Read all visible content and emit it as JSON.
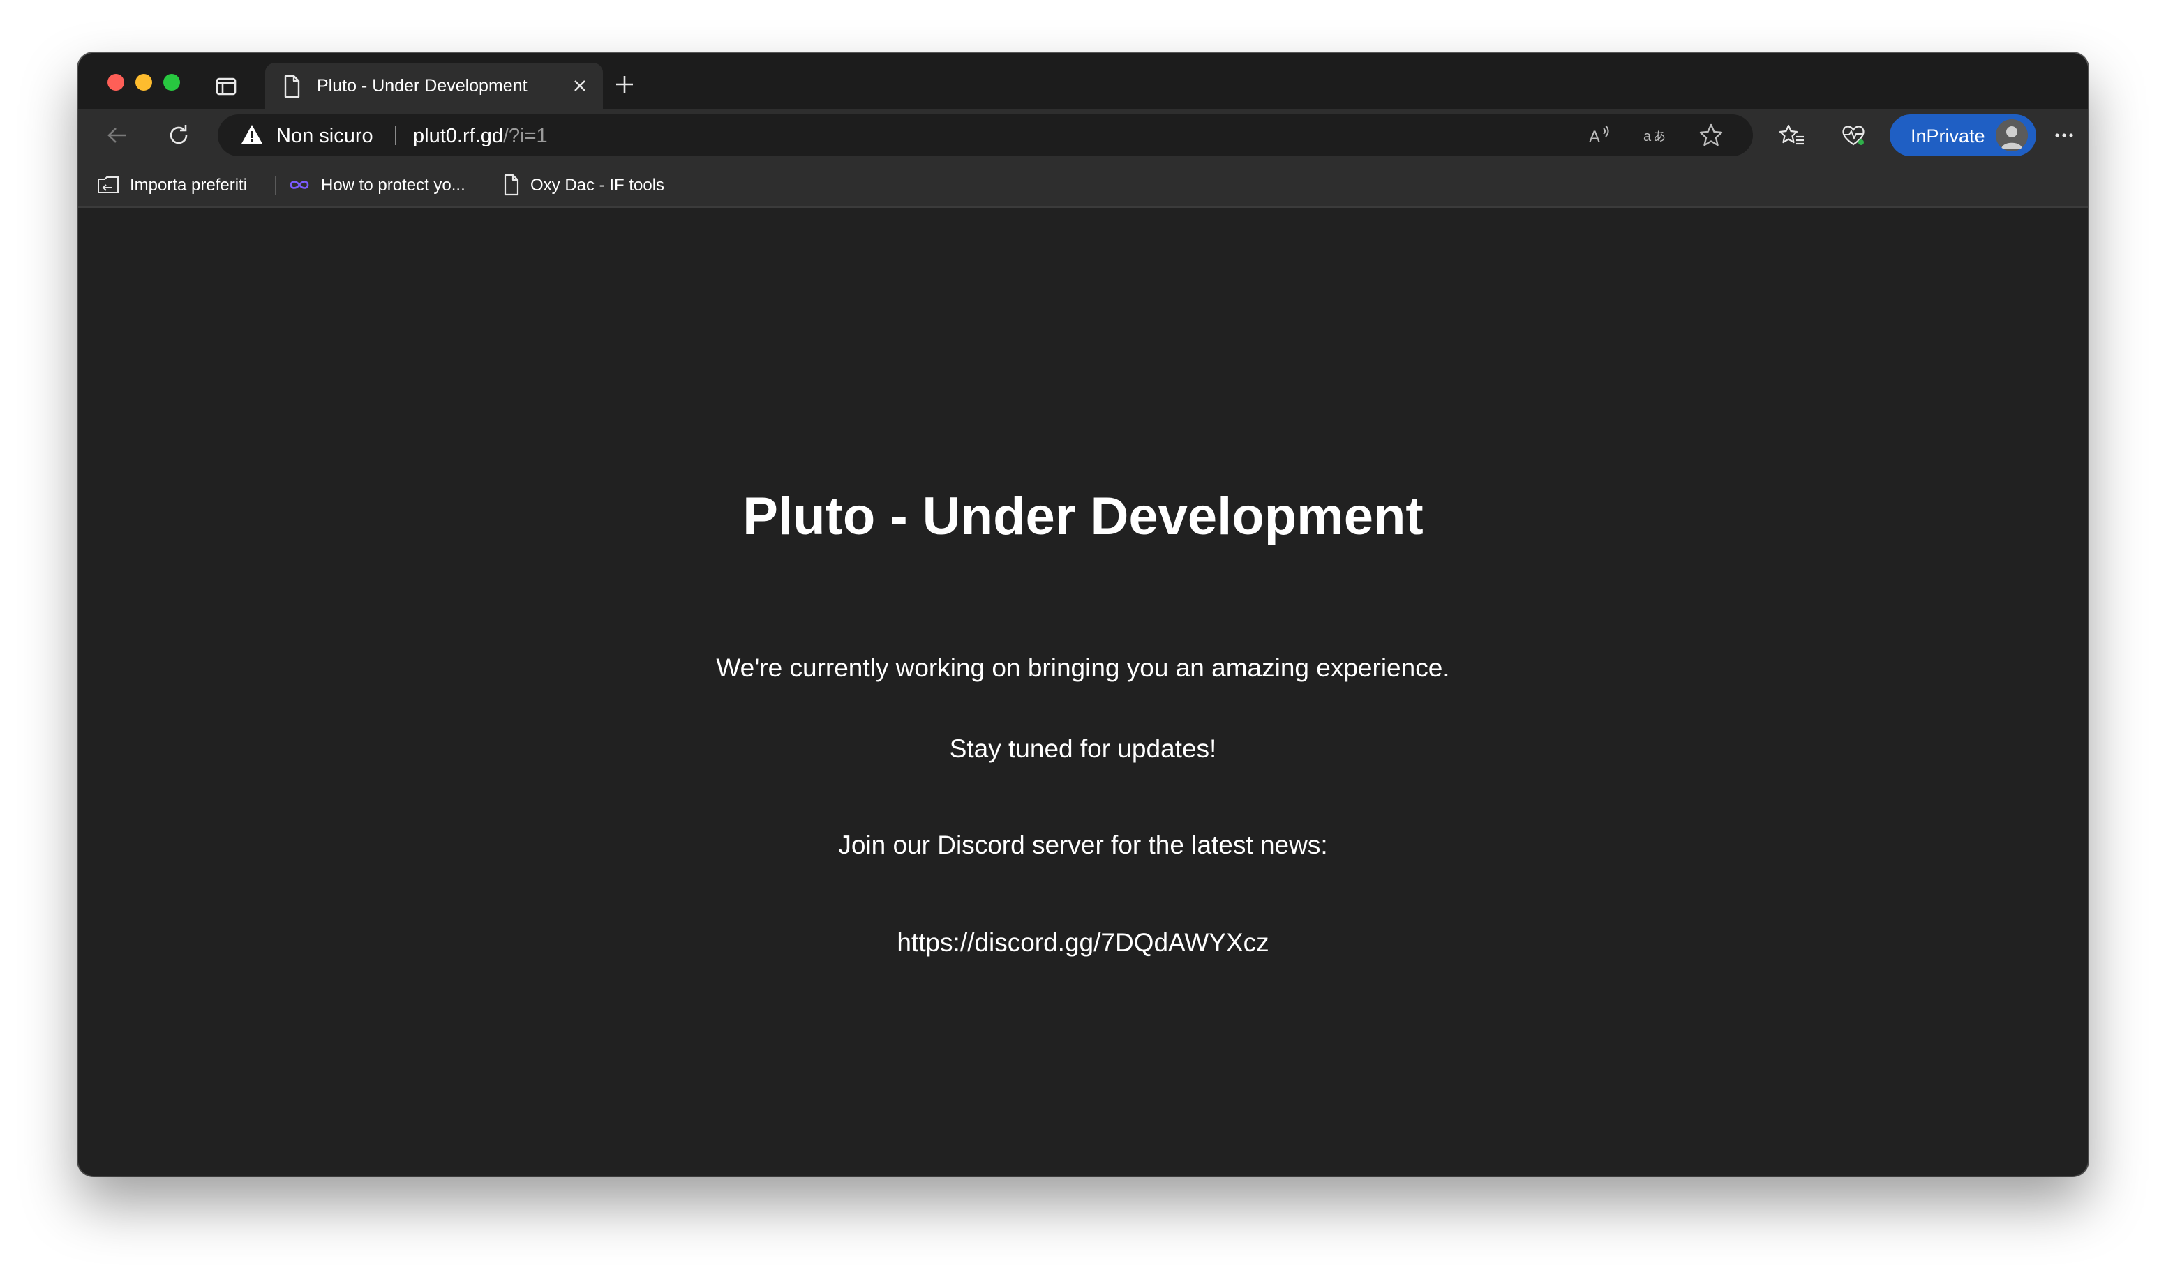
{
  "browser": {
    "tab": {
      "title": "Pluto - Under Development"
    },
    "address_bar": {
      "security_label": "Non sicuro",
      "url_host": "plut0.rf.gd",
      "url_path": "/?i=1"
    },
    "inprivate_label": "InPrivate",
    "bookmarks": [
      {
        "label": "Importa preferiti"
      },
      {
        "label": "How to protect yo..."
      },
      {
        "label": "Oxy Dac - IF tools"
      }
    ]
  },
  "page": {
    "heading": "Pluto - Under Development",
    "intro": "We're currently working on bringing you an amazing experience.",
    "stay_tuned": "Stay tuned for updates!",
    "discord_prompt": "Join our Discord server for the latest news:",
    "discord_link": "https://discord.gg/7DQdAWYXcz"
  },
  "colors": {
    "page_background": "#212121",
    "toolbar": "#2e2e2e",
    "tab_strip": "#1c1c1c",
    "inprivate_accent": "#1f5fc4",
    "text": "#ffffff"
  },
  "icons": {
    "window_close": "traffic-light-close",
    "window_minimize": "traffic-light-minimize",
    "window_maximize": "traffic-light-maximize",
    "tab_actions": "tab-actions-icon",
    "tab_favicon": "document-icon",
    "tab_close": "close-icon",
    "new_tab": "plus-icon",
    "back": "back-arrow-icon",
    "reload": "reload-icon",
    "security": "warning-triangle-icon",
    "read_aloud": "read-aloud-icon",
    "translate": "translate-icon",
    "favorite": "star-icon",
    "favorites": "favorites-icon",
    "browser_essentials": "heart-pulse-icon",
    "more": "more-dots-icon"
  }
}
